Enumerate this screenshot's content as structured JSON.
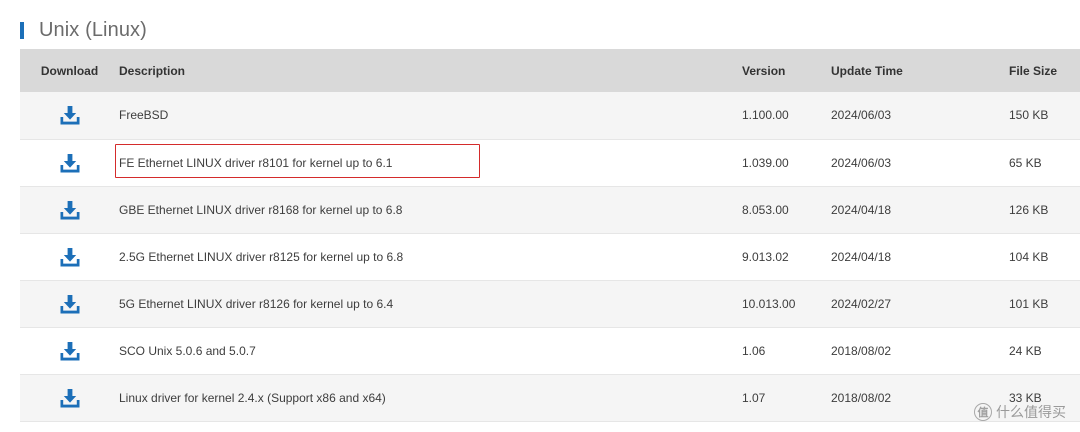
{
  "section": {
    "title": "Unix (Linux)"
  },
  "table": {
    "headers": {
      "download": "Download",
      "description": "Description",
      "version": "Version",
      "update_time": "Update Time",
      "file_size": "File Size"
    },
    "rows": [
      {
        "description": "FreeBSD",
        "version": "1.100.00",
        "update_time": "2024/06/03",
        "file_size": "150 KB"
      },
      {
        "description": "FE Ethernet LINUX driver r8101 for kernel up to 6.1",
        "version": "1.039.00",
        "update_time": "2024/06/03",
        "file_size": "65 KB"
      },
      {
        "description": "GBE Ethernet LINUX driver r8168 for kernel up to 6.8",
        "version": "8.053.00",
        "update_time": "2024/04/18",
        "file_size": "126 KB"
      },
      {
        "description": "2.5G Ethernet LINUX driver r8125 for kernel up to 6.8",
        "version": "9.013.02",
        "update_time": "2024/04/18",
        "file_size": "104 KB"
      },
      {
        "description": "5G Ethernet LINUX driver r8126 for kernel up to 6.4",
        "version": "10.013.00",
        "update_time": "2024/02/27",
        "file_size": "101 KB"
      },
      {
        "description": "SCO Unix 5.0.6 and 5.0.7",
        "version": "1.06",
        "update_time": "2018/08/02",
        "file_size": "24 KB"
      },
      {
        "description": "Linux driver for kernel 2.4.x (Support x86 and x64)",
        "version": "1.07",
        "update_time": "2018/08/02",
        "file_size": "33 KB"
      }
    ]
  },
  "colors": {
    "accent": "#1c6fb8",
    "highlight": "#d42b2b"
  },
  "icons": {
    "download": "download-tray-icon"
  },
  "watermark": {
    "mark": "值",
    "text": "什么值得买"
  }
}
